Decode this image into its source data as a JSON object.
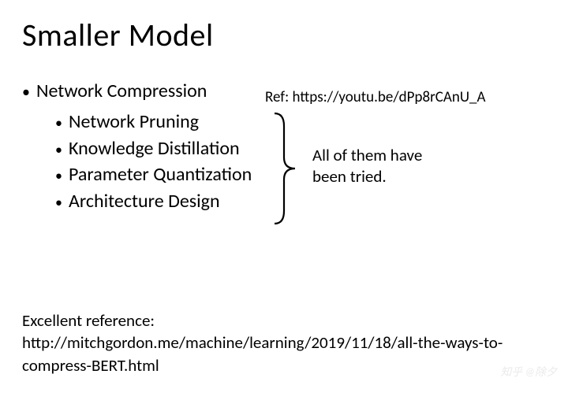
{
  "title": "Smaller Model",
  "main_bullet": "Network Compression",
  "sub_bullets": [
    "Network Pruning",
    "Knowledge Distillation",
    "Parameter Quantization",
    "Architecture Design"
  ],
  "ref_top": "Ref: https://youtu.be/dPp8rCAnU_A",
  "annotation_line1": "All of them have",
  "annotation_line2": "been tried.",
  "footer_label": "Excellent reference:",
  "footer_url": "http://mitchgordon.me/machine/learning/2019/11/18/all-the-ways-to-compress-BERT.html",
  "watermark": "知乎 @除夕"
}
